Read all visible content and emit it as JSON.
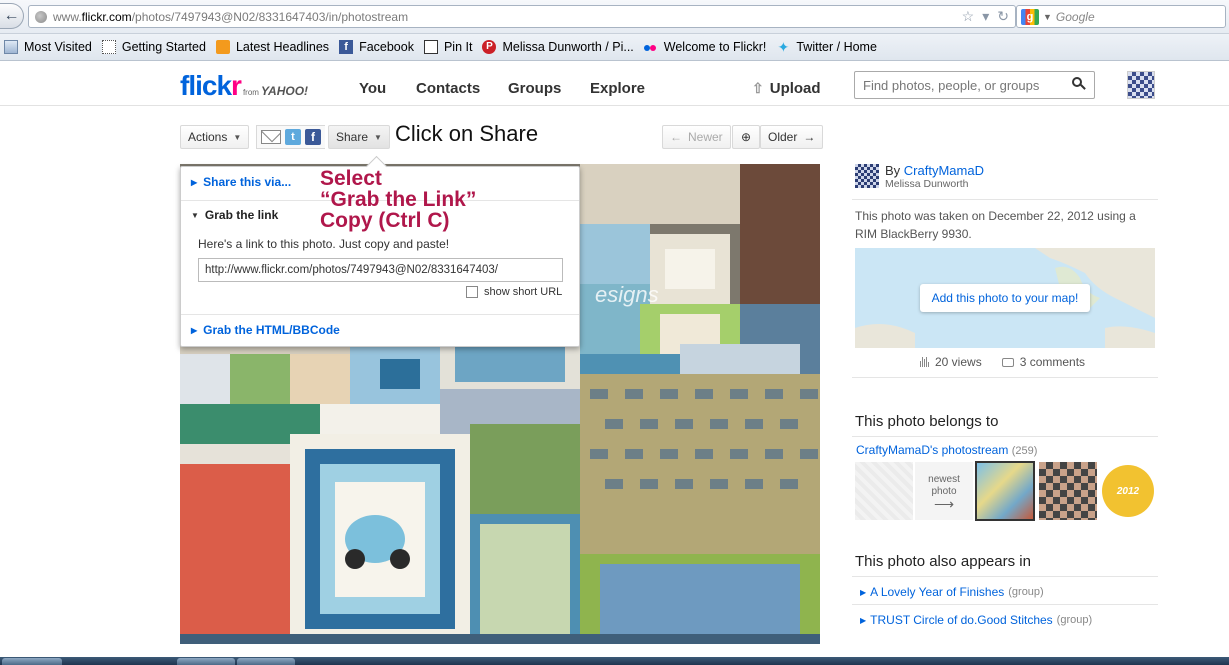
{
  "browser": {
    "url_prefix": "www.",
    "url_domain": "flickr.com",
    "url_path": "/photos/7497943@N02/8331647403/in/photostream",
    "search_engine_placeholder": "Google"
  },
  "bookmarks": [
    {
      "label": "Most Visited",
      "icon": "bookmarks-bar-icon"
    },
    {
      "label": "Getting Started",
      "icon": "page-icon"
    },
    {
      "label": "Latest Headlines",
      "icon": "rss-icon"
    },
    {
      "label": "Facebook",
      "icon": "facebook-icon"
    },
    {
      "label": "Pin It",
      "icon": "pin-icon"
    },
    {
      "label": "Melissa Dunworth / Pi...",
      "icon": "pinterest-icon"
    },
    {
      "label": "Welcome to Flickr!",
      "icon": "flickr-icon"
    },
    {
      "label": "Twitter / Home",
      "icon": "twitter-icon"
    }
  ],
  "header": {
    "logo_part1": "flick",
    "logo_part2": "r",
    "logo_from": "from",
    "logo_yahoo": "YAHOO!",
    "nav": [
      "You",
      "Contacts",
      "Groups",
      "Explore"
    ],
    "upload": "Upload",
    "search_placeholder": "Find photos, people, or groups"
  },
  "toolbar": {
    "actions": "Actions",
    "share": "Share",
    "newer": "Newer",
    "older": "Older",
    "annotation": "Click on Share"
  },
  "share_panel": {
    "share_via": "Share this via...",
    "grab_link": "Grab the link",
    "help_text": "Here's a link to this photo. Just copy and paste!",
    "link_value": "http://www.flickr.com/photos/7497943@N02/8331647403/",
    "short_url": "show short URL",
    "grab_html": "Grab the HTML/BBCode"
  },
  "annotation_select": [
    "Select",
    "“Grab the Link”",
    "Copy (Ctrl C)"
  ],
  "photo_watermark": "esigns",
  "sidebar": {
    "by": "By",
    "owner": "CraftyMamaD",
    "real_name": "Melissa Dunworth",
    "taken": "This photo was taken on December 22, 2012 using a RIM BlackBerry 9930.",
    "map_button": "Add this photo to your map!",
    "views": "20 views",
    "comments": "3 comments",
    "belongs_title": "This photo belongs to",
    "stream_name": "CraftyMamaD's photostream",
    "stream_count": "(259)",
    "newest_label": "newest photo",
    "badge_text": "2012",
    "appears_title": "This photo also appears in",
    "groups": [
      {
        "name": "A Lovely Year of Finishes",
        "tag": "(group)"
      },
      {
        "name": "TRUST Circle of do.Good Stitches",
        "tag": "(group)"
      }
    ]
  },
  "colors": {
    "flickr_blue": "#0063dc",
    "flickr_pink": "#ff0084",
    "annotation_red": "#b0174b"
  }
}
